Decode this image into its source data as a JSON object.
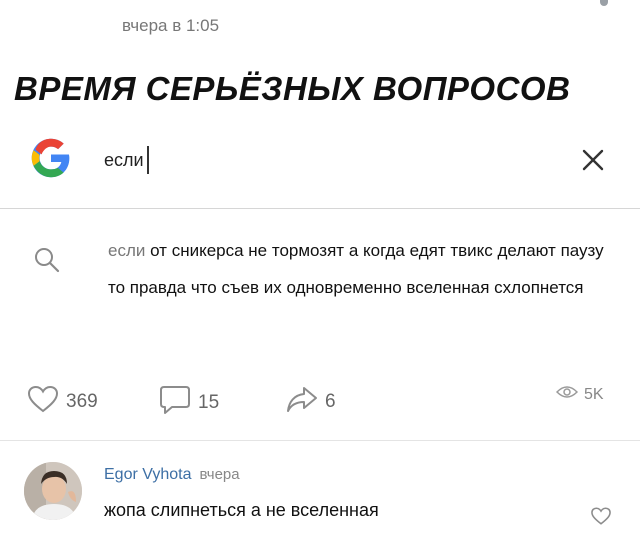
{
  "post": {
    "timestamp": "вчера в 1:05",
    "title": "ВРЕМЯ СЕРЬЁЗНЫХ ВОПРОСОВ"
  },
  "search": {
    "logo_icon": "google-g-icon",
    "query": "если",
    "close_icon": "close-icon",
    "suggestion_icon": "search-icon",
    "suggestion_query": "если",
    "suggestion_rest": " от сникерса не тормозят а когда едят твикс делают паузу то правда что съев их одновременно вселенная схлопнется"
  },
  "actions": {
    "likes": "369",
    "comments": "15",
    "shares": "6",
    "views": "5K"
  },
  "comment": {
    "author": "Egor Vyhota",
    "time": "вчера",
    "text": "жопа слипнеться а не вселенная"
  },
  "colors": {
    "author_link": "#3d6fa5",
    "muted": "#777777",
    "google_blue": "#4285F4",
    "google_red": "#EA4335",
    "google_yellow": "#FBBC05",
    "google_green": "#34A853"
  }
}
